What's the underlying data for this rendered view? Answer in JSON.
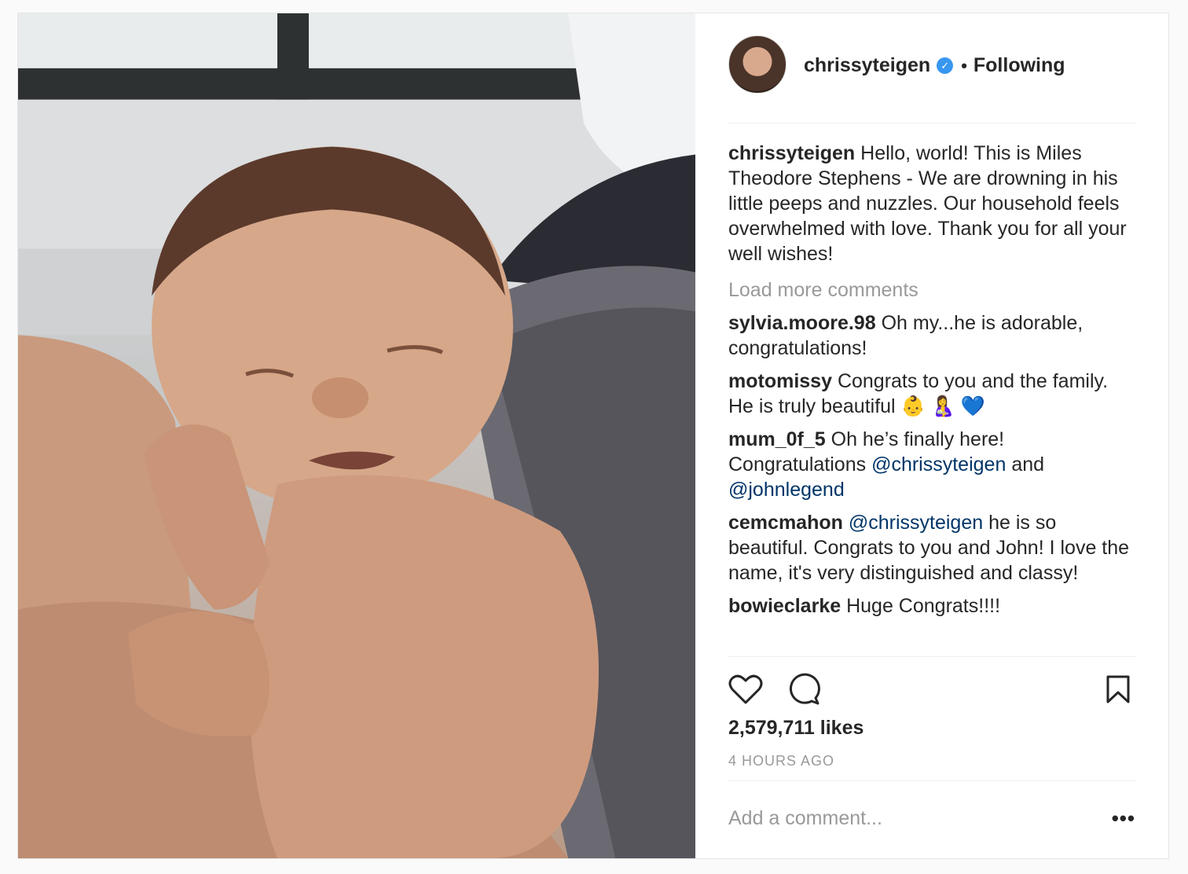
{
  "post": {
    "photo_alt": "",
    "author": "chrissyteigen",
    "follow_status": "Following",
    "caption": {
      "user": "chrissyteigen",
      "text": "Hello, world! This is Miles Theodore Stephens - We are drowning in his little peeps and nuzzles. Our household feels overwhelmed with love. Thank you for all your well wishes!"
    },
    "load_more_label": "Load more comments",
    "comments": [
      {
        "user": "sylvia.moore.98",
        "text": "Oh my...he is adorable, congratulations!"
      },
      {
        "user": "motomissy",
        "text": "Congrats to you and the family. He is truly beautiful 👶 🤱 💙"
      },
      {
        "user": "mum_0f_5",
        "text_a": "Oh he’s finally here! Congratulations",
        "mention_a": "@chrissyteigen",
        "text_b": "and",
        "mention_b": "@johnlegend"
      },
      {
        "user": "cemcmahon",
        "mention": "@chrissyteigen",
        "text": "he is so beautiful. Congrats to you and John! I love the name, it's very distinguished and classy!"
      },
      {
        "user": "bowieclarke",
        "text": "Huge Congrats!!!!"
      }
    ],
    "likes": "2,579,711 likes",
    "time_ago": "4 HOURS AGO",
    "add_comment_placeholder": "Add a comment...",
    "more_label": "•••"
  },
  "icons": [
    "verified-badge-icon",
    "heart-icon",
    "comment-icon",
    "bookmark-icon",
    "more-options-icon"
  ],
  "colors": {
    "link": "#003569",
    "muted": "#999999",
    "verified": "#3897f0",
    "text": "#262626"
  }
}
